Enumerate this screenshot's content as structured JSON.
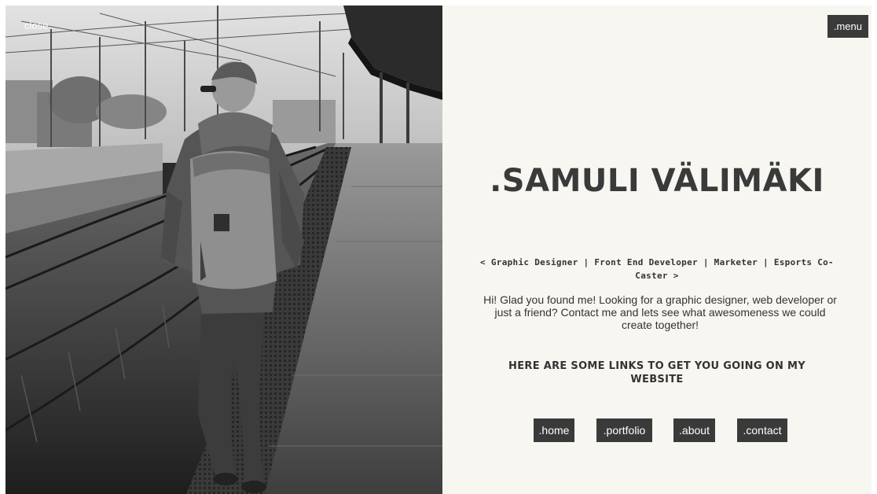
{
  "photo": {
    "close_label": "close",
    "icons": {
      "person": "traveler-with-backpack",
      "rails": "railway-tracks",
      "platform": "train-platform",
      "canopy": "station-canopy"
    }
  },
  "header": {
    "menu_label": ".menu"
  },
  "hero": {
    "title": ".SAMULI VÄLIMÄKI",
    "roles": "< Graphic Designer | Front End Developer | Marketer | Esports Co-Caster >",
    "intro": "Hi! Glad you found me! Looking for a graphic designer, web developer or just a friend? Contact me and lets see what awesomeness we could create together!",
    "links_heading": "HERE ARE SOME LINKS TO GET YOU GOING ON MY WEBSITE"
  },
  "nav": {
    "items": [
      {
        "label": ".home"
      },
      {
        "label": ".portfolio"
      },
      {
        "label": ".about"
      },
      {
        "label": ".contact"
      }
    ]
  },
  "colors": {
    "panel_background": "#f7f6f0",
    "button_background": "#3a3a3a",
    "button_text": "#ffffff",
    "text": "#333333"
  }
}
